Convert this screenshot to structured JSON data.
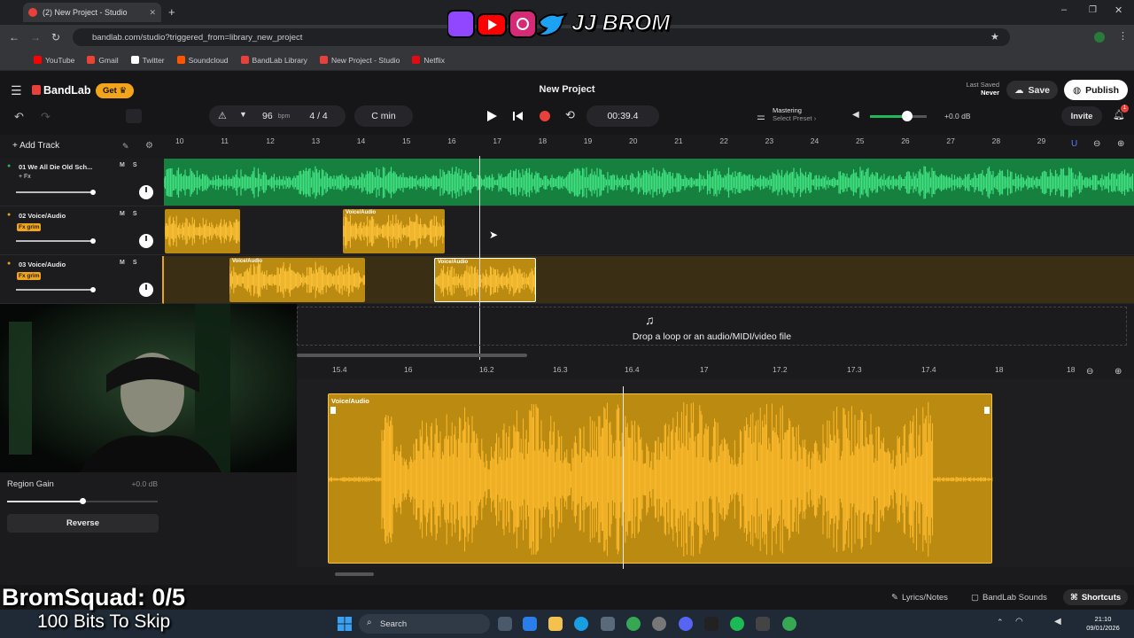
{
  "browser": {
    "tab_title": "(2) New Project - Studio",
    "url": "bandlab.com/studio?triggered_from=library_new_project",
    "bookmarks": [
      {
        "label": "YouTube",
        "color": "#ff0000"
      },
      {
        "label": "Gmail",
        "color": "#ea4335"
      },
      {
        "label": "Twitter",
        "color": "#ffffff"
      },
      {
        "label": "Soundcloud",
        "color": "#ff5500"
      },
      {
        "label": "BandLab Library",
        "color": "#e8413c"
      },
      {
        "label": "New Project - Studio",
        "color": "#e8413c"
      },
      {
        "label": "Netflix",
        "color": "#e50914"
      }
    ]
  },
  "stream_banner": {
    "text": "JJ BROM"
  },
  "header": {
    "brand": "BandLab",
    "get_label": "Get",
    "project_title": "New Project",
    "last_saved_label": "Last Saved",
    "last_saved_value": "Never",
    "save_label": "Save",
    "publish_label": "Publish"
  },
  "transport": {
    "bpm": "96",
    "bpm_unit": "bpm",
    "time_signature": "4 / 4",
    "key": "C min",
    "time": "00:39.4",
    "mastering_title": "Mastering",
    "mastering_preset": "Select Preset ›",
    "volume": "+0.0 dB",
    "invite_label": "Invite",
    "notification_count": "1"
  },
  "timeline": {
    "add_track_label": "Add Track",
    "ruler": [
      "10",
      "11",
      "12",
      "13",
      "14",
      "15",
      "16",
      "17",
      "18",
      "19",
      "20",
      "21",
      "22",
      "23",
      "24",
      "25",
      "26",
      "27",
      "28",
      "29"
    ]
  },
  "tracks": [
    {
      "name": "01  We All Die Old Sch...",
      "fx": "+ Fx",
      "fx_named": false,
      "mute": "M",
      "solo": "S"
    },
    {
      "name": "02  Voice/Audio",
      "fx": "Fx grim",
      "fx_named": true,
      "mute": "M",
      "solo": "S"
    },
    {
      "name": "03  Voice/Audio",
      "fx": "Fx grim",
      "fx_named": true,
      "mute": "M",
      "solo": "S"
    }
  ],
  "regions": {
    "label": "Voice/Audio"
  },
  "dropzone": {
    "text": "Drop a loop or an audio/MIDI/video file"
  },
  "editor": {
    "ruler": [
      "15.4",
      "16",
      "16.2",
      "16.3",
      "16.4",
      "17",
      "17.2",
      "17.3",
      "17.4",
      "18",
      "18"
    ],
    "region_label": "Voice/Audio"
  },
  "region_panel": {
    "gain_label": "Region Gain",
    "gain_value": "+0.0 dB",
    "gain_level": 0.5,
    "reverse_label": "Reverse"
  },
  "bottom_tabs": {
    "lyrics": "Lyrics/Notes",
    "sounds": "BandLab Sounds",
    "shortcuts": "Shortcuts"
  },
  "overlay": {
    "squad": "BromSquad: 0/5",
    "bits": "100 Bits To Skip"
  },
  "taskbar": {
    "search_placeholder": "Search",
    "time": "21:10",
    "date": "09/01/2026"
  },
  "colors": {
    "green_track": "#1fb85a",
    "gold_region": "#e6a817",
    "accent_red": "#e8413c"
  }
}
